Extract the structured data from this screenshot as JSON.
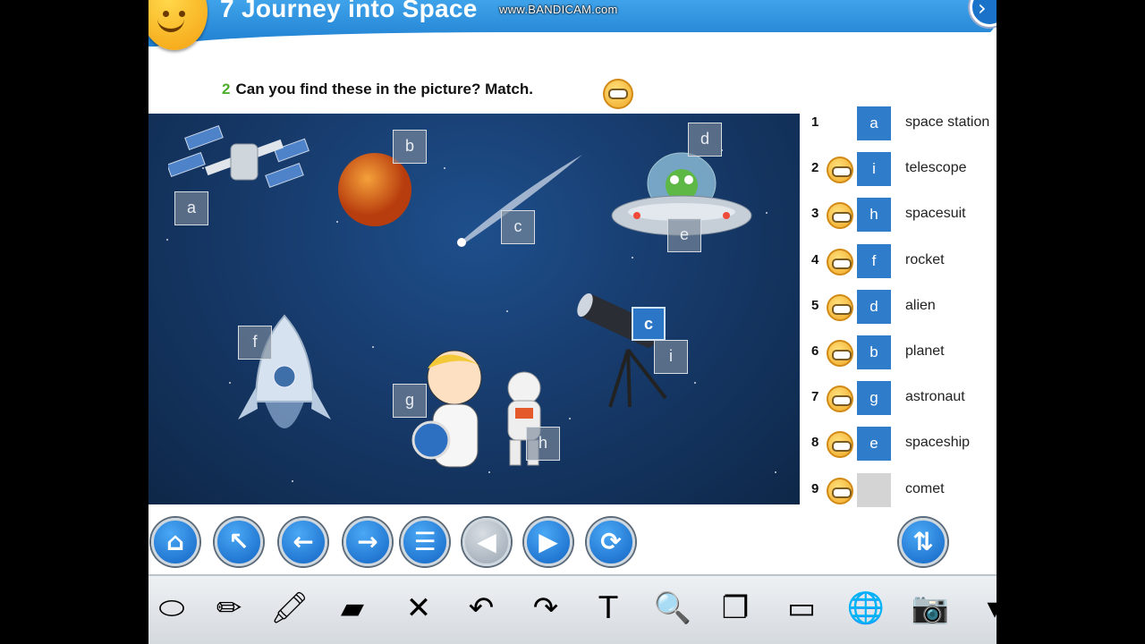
{
  "app": {
    "unit_title": "7 Journey into Space",
    "watermark": "www.BANDICAM.com",
    "close_glyph": "›"
  },
  "instruction": {
    "number": "2",
    "text": "Can you find these in the picture? Match."
  },
  "scene_tags": [
    {
      "label": "a",
      "selected": false
    },
    {
      "label": "b",
      "selected": false
    },
    {
      "label": "c",
      "selected": false
    },
    {
      "label": "d",
      "selected": false
    },
    {
      "label": "e",
      "selected": false
    },
    {
      "label": "f",
      "selected": false
    },
    {
      "label": "c",
      "selected": true
    },
    {
      "label": "i",
      "selected": false
    },
    {
      "label": "g",
      "selected": false
    },
    {
      "label": "h",
      "selected": false
    }
  ],
  "matches": [
    {
      "num": "1",
      "letter": "a",
      "word": "space station",
      "audio": false
    },
    {
      "num": "2",
      "letter": "i",
      "word": "telescope",
      "audio": true
    },
    {
      "num": "3",
      "letter": "h",
      "word": "spacesuit",
      "audio": true
    },
    {
      "num": "4",
      "letter": "f",
      "word": "rocket",
      "audio": true
    },
    {
      "num": "5",
      "letter": "d",
      "word": "alien",
      "audio": true
    },
    {
      "num": "6",
      "letter": "b",
      "word": "planet",
      "audio": true
    },
    {
      "num": "7",
      "letter": "g",
      "word": "astronaut",
      "audio": true
    },
    {
      "num": "8",
      "letter": "e",
      "word": "spaceship",
      "audio": true
    },
    {
      "num": "9",
      "letter": "",
      "word": "comet",
      "audio": true
    }
  ],
  "nav_buttons": [
    {
      "icon": "home-icon",
      "glyph": "⌂"
    },
    {
      "icon": "arrow-up-left-icon",
      "glyph": "↖"
    },
    {
      "icon": "arrow-left-icon",
      "glyph": "←"
    },
    {
      "icon": "arrow-right-icon",
      "glyph": "→"
    },
    {
      "icon": "list-icon",
      "glyph": "☰"
    },
    {
      "icon": "play-back-icon",
      "glyph": "◀"
    },
    {
      "icon": "play-forward-icon",
      "glyph": "▶"
    },
    {
      "icon": "refresh-icon",
      "glyph": "⟳"
    },
    {
      "icon": "swap-icon",
      "glyph": "⇅"
    }
  ],
  "tools": [
    {
      "icon": "eraser-icon",
      "glyph": "⬭"
    },
    {
      "icon": "pencil-icon",
      "glyph": "✏"
    },
    {
      "icon": "marker-icon",
      "glyph": "🖍"
    },
    {
      "icon": "highlighter-icon",
      "glyph": "▰"
    },
    {
      "icon": "clear-icon",
      "glyph": "✕"
    },
    {
      "icon": "undo-icon",
      "glyph": "↶"
    },
    {
      "icon": "redo-icon",
      "glyph": "↷"
    },
    {
      "icon": "textbox-icon",
      "glyph": "T"
    },
    {
      "icon": "zoom-icon",
      "glyph": "🔍"
    },
    {
      "icon": "window-icon",
      "glyph": "❐"
    },
    {
      "icon": "blank-screen-icon",
      "glyph": "▭"
    },
    {
      "icon": "globe-icon",
      "glyph": "🌐"
    },
    {
      "icon": "camera-icon",
      "glyph": "📷"
    },
    {
      "icon": "more-icon",
      "glyph": "▾"
    }
  ],
  "colors": {
    "header_blue": "#1f7fd0",
    "answer_box_blue": "#2f7ccb",
    "empty_box": "#d4d4d4",
    "instruction_number_green": "#4cae2a"
  }
}
